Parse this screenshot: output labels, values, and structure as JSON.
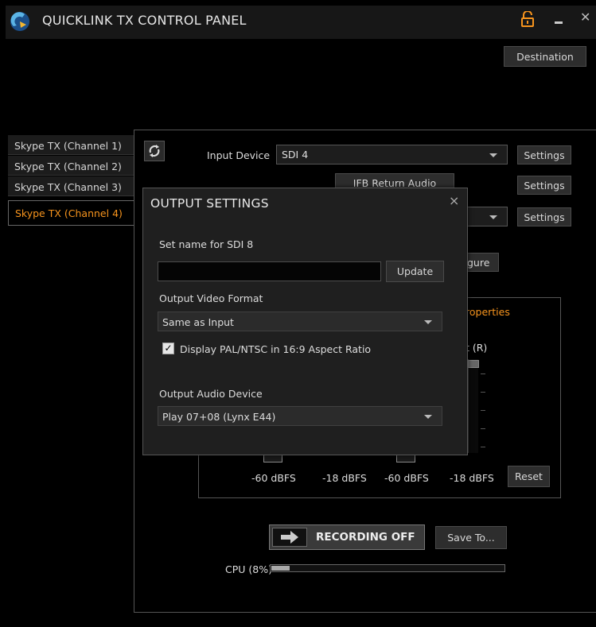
{
  "app": {
    "title": "QUICKLINK TX CONTROL PANEL"
  },
  "header": {
    "destination_label": "Destination"
  },
  "sidebar": {
    "items": [
      {
        "label": "Skype TX (Channel 1)"
      },
      {
        "label": "Skype TX (Channel 2)"
      },
      {
        "label": "Skype TX (Channel 3)"
      },
      {
        "label": "Skype TX (Channel 4)"
      }
    ],
    "active_index": 3
  },
  "panel": {
    "input_device_label": "Input Device",
    "input_device_value": "SDI 4",
    "settings_label": "Settings",
    "ifb_return_audio_label": "IFB Return Audio",
    "configure_fragment": "gure",
    "properties_fragment": "roperties",
    "right_channel_fragment": "t (R)",
    "dbfs_labels": [
      "-60 dBFS",
      "-18 dBFS",
      "-60 dBFS",
      "-18 dBFS"
    ],
    "reset_label": "Reset",
    "recording_label": "RECORDING OFF",
    "save_to_label": "Save To...",
    "cpu_label": "CPU (8%)",
    "cpu_percent": 8
  },
  "dialog": {
    "title": "OUTPUT SETTINGS",
    "close_glyph": "×",
    "name_label": "Set name for SDI 8",
    "name_value": "",
    "update_label": "Update",
    "video_format_label": "Output Video Format",
    "video_format_value": "Same as Input",
    "aspect_checkbox_label": "Display PAL/NTSC in 16:9 Aspect Ratio",
    "aspect_checked": true,
    "audio_device_label": "Output Audio Device",
    "audio_device_value": "Play 07+08 (Lynx E44)"
  },
  "colors": {
    "accent": "#f7941d",
    "background": "#000000",
    "dialog_bg": "#1f1f1f",
    "button_bg": "#2d2d2d"
  },
  "icons": {
    "logo": "quicklink-logo-icon",
    "lock": "unlock-icon",
    "refresh": "refresh-icon",
    "arrow": "arrow-right-icon"
  }
}
